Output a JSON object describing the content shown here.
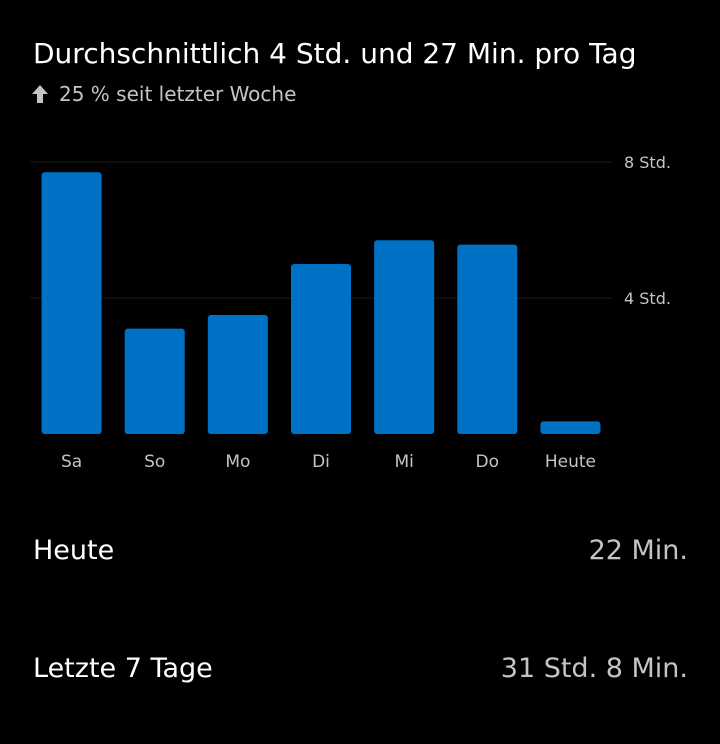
{
  "header": {
    "title": "Durchschnittlich 4 Std. und 27 Min. pro Tag",
    "trend_text": "25 % seit letzter Woche",
    "trend_icon": "arrow-up-icon"
  },
  "colors": {
    "background": "#000000",
    "bar": "#0072c6",
    "gridline": "#1a1a1a",
    "muted_text": "#c4c4c4"
  },
  "chart_data": {
    "type": "bar",
    "categories": [
      "Sa",
      "So",
      "Mo",
      "Di",
      "Mi",
      "Do",
      "Heute"
    ],
    "values": [
      7.7,
      3.1,
      3.5,
      5.0,
      5.7,
      5.57,
      0.37
    ],
    "ylim": [
      0,
      8
    ],
    "y_ticks": [
      {
        "value": 8,
        "label": "8 Std."
      },
      {
        "value": 4,
        "label": "4 Std."
      }
    ],
    "grid": true,
    "y_axis_side": "right"
  },
  "stats": {
    "today_label": "Heute",
    "today_value": "22 Min.",
    "week_label": "Letzte 7 Tage",
    "week_value": "31 Std. 8 Min."
  }
}
